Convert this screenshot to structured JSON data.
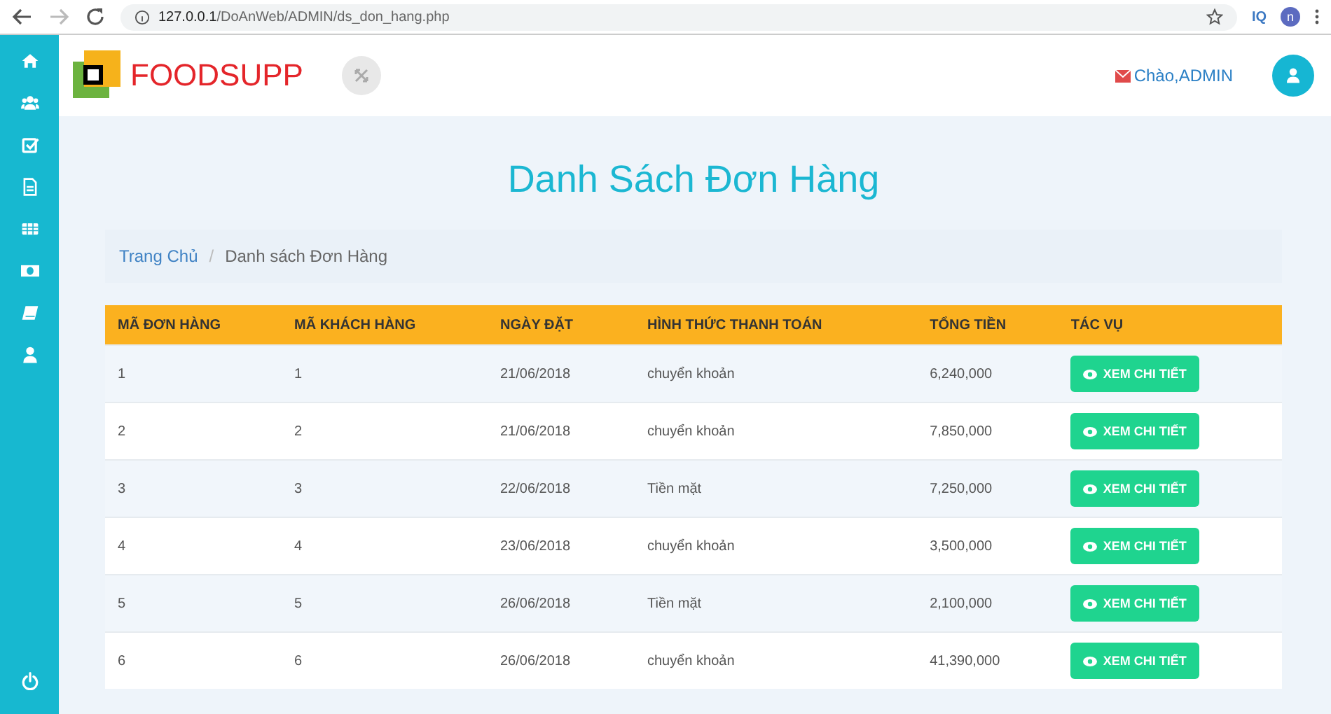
{
  "browser": {
    "url_host": "127.0.0.1",
    "url_path": "/DoAnWeb/ADMIN/ds_don_hang.php",
    "extension": "IQ",
    "profile": "n"
  },
  "header": {
    "brand": "FOODSUPP",
    "greeting": "Chào,ADMIN"
  },
  "page": {
    "title": "Danh Sách Đơn Hàng",
    "breadcrumb_separator": "/",
    "breadcrumb": [
      {
        "label": "Trang Chủ",
        "kind": "link"
      },
      {
        "label": "Danh sách Đơn Hàng",
        "kind": "current"
      }
    ]
  },
  "table": {
    "columns": [
      "MÃ ĐƠN HÀNG",
      "MÃ KHÁCH HÀNG",
      "NGÀY ĐẶT",
      "HÌNH THỨC THANH TOÁN",
      "TỔNG TIỀN",
      "TÁC VỤ"
    ],
    "rows": [
      {
        "order_id": "1",
        "customer_id": "1",
        "date": "21/06/2018",
        "payment": "chuyển khoản",
        "total": "6,240,000",
        "action": "XEM CHI TIẾT"
      },
      {
        "order_id": "2",
        "customer_id": "2",
        "date": "21/06/2018",
        "payment": "chuyển khoản",
        "total": "7,850,000",
        "action": "XEM CHI TIẾT"
      },
      {
        "order_id": "3",
        "customer_id": "3",
        "date": "22/06/2018",
        "payment": "Tiền mặt",
        "total": "7,250,000",
        "action": "XEM CHI TIẾT"
      },
      {
        "order_id": "4",
        "customer_id": "4",
        "date": "23/06/2018",
        "payment": "chuyển khoản",
        "total": "3,500,000",
        "action": "XEM CHI TIẾT"
      },
      {
        "order_id": "5",
        "customer_id": "5",
        "date": "26/06/2018",
        "payment": "Tiền mặt",
        "total": "2,100,000",
        "action": "XEM CHI TIẾT"
      },
      {
        "order_id": "6",
        "customer_id": "6",
        "date": "26/06/2018",
        "payment": "chuyển khoản",
        "total": "41,390,000",
        "action": "XEM CHI TIẾT"
      }
    ]
  }
}
